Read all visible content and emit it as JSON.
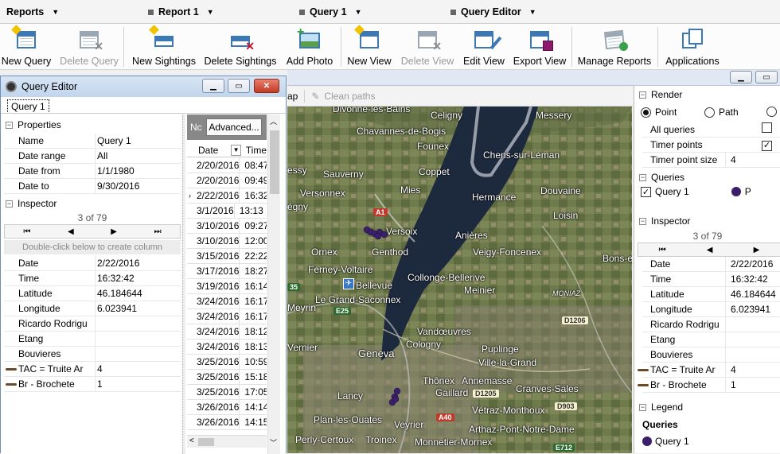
{
  "tabs": [
    {
      "label": "Reports"
    },
    {
      "label": "Report 1"
    },
    {
      "label": "Query 1"
    },
    {
      "label": "Query Editor"
    }
  ],
  "ribbon": {
    "new_query": "New Query",
    "delete_query": "Delete Query",
    "new_sightings": "New Sightings",
    "delete_sightings": "Delete Sightings",
    "add_photo": "Add Photo",
    "new_view": "New View",
    "delete_view": "Delete View",
    "edit_view": "Edit View",
    "export_view": "Export View",
    "manage_reports": "Manage Reports",
    "applications": "Applications"
  },
  "query_editor": {
    "title": "Query Editor",
    "tab": "Query 1",
    "properties_header": "Properties",
    "properties": [
      {
        "key": "Name",
        "value": "Query 1"
      },
      {
        "key": "Date range",
        "value": "All"
      },
      {
        "key": "Date from",
        "value": "1/1/1980"
      },
      {
        "key": "Date to",
        "value": "9/30/2016"
      }
    ],
    "inspector_header": "Inspector",
    "inspector_count": "3 of 79",
    "create_column_hint": "Double-click below to create column",
    "inspector": [
      {
        "key": "Date",
        "value": "2/22/2016"
      },
      {
        "key": "Time",
        "value": "16:32:42"
      },
      {
        "key": "Latitude",
        "value": "46.184644"
      },
      {
        "key": "Longitude",
        "value": "6.023941"
      },
      {
        "key": "Ricardo Rodrigu",
        "value": ""
      },
      {
        "key": "Etang",
        "value": ""
      },
      {
        "key": "Bouvieres",
        "value": ""
      },
      {
        "key": "TAC = Truite Ar",
        "value": "4"
      },
      {
        "key": "Br - Brochete",
        "value": "1"
      }
    ],
    "advanced_label": "Advanced...",
    "nc_label": "Nc",
    "date_col": "Date",
    "time_col": "Time",
    "rows": [
      {
        "date": "2/20/2016",
        "time": "08:47"
      },
      {
        "date": "2/20/2016",
        "time": "09:49"
      },
      {
        "date": "2/22/2016",
        "time": "16:32"
      },
      {
        "date": "3/1/2016",
        "time": "13:13"
      },
      {
        "date": "3/10/2016",
        "time": "09:27"
      },
      {
        "date": "3/10/2016",
        "time": "12:00"
      },
      {
        "date": "3/15/2016",
        "time": "22:22"
      },
      {
        "date": "3/17/2016",
        "time": "18:27"
      },
      {
        "date": "3/19/2016",
        "time": "16:14"
      },
      {
        "date": "3/24/2016",
        "time": "16:17"
      },
      {
        "date": "3/24/2016",
        "time": "16:17"
      },
      {
        "date": "3/24/2016",
        "time": "18:12"
      },
      {
        "date": "3/24/2016",
        "time": "18:13"
      },
      {
        "date": "3/25/2016",
        "time": "10:59"
      },
      {
        "date": "3/25/2016",
        "time": "15:18"
      },
      {
        "date": "3/25/2016",
        "time": "17:05"
      },
      {
        "date": "3/26/2016",
        "time": "14:14"
      },
      {
        "date": "3/26/2016",
        "time": "14:15"
      }
    ]
  },
  "map_toolbar": {
    "left_label": "ap",
    "clean_paths": "Clean paths"
  },
  "map_labels": [
    {
      "text": "Divonne-les-Bains"
    },
    {
      "text": "Celigny"
    },
    {
      "text": "Messery"
    },
    {
      "text": "Chavannes-de-Bogis"
    },
    {
      "text": "Founex"
    },
    {
      "text": "Chens-sur-Léman"
    },
    {
      "text": "essy"
    },
    {
      "text": "Sauverny"
    },
    {
      "text": "Coppet"
    },
    {
      "text": "Versonnex"
    },
    {
      "text": "Mies"
    },
    {
      "text": "Hermance"
    },
    {
      "text": "Douvaine"
    },
    {
      "text": "égny"
    },
    {
      "text": "Loisin"
    },
    {
      "text": "Versoix"
    },
    {
      "text": "Anières"
    },
    {
      "text": "Ornex"
    },
    {
      "text": "Genthod"
    },
    {
      "text": "Veigy-Foncenex"
    },
    {
      "text": "Bons-e"
    },
    {
      "text": "Ferney-Voltaire"
    },
    {
      "text": "Collonge-Bellerive"
    },
    {
      "text": "Bellevue"
    },
    {
      "text": "Meinier"
    },
    {
      "text": "Meyrin"
    },
    {
      "text": "Le Grand-Saconnex"
    },
    {
      "text": "Vandœuvres"
    },
    {
      "text": "Vernier"
    },
    {
      "text": "Cologny"
    },
    {
      "text": "Puplinge"
    },
    {
      "text": "Geneva"
    },
    {
      "text": "Ville-la-Grand"
    },
    {
      "text": "Thônex"
    },
    {
      "text": "Annemasse"
    },
    {
      "text": "Gaillard"
    },
    {
      "text": "Cranves-Sales"
    },
    {
      "text": "Lancy"
    },
    {
      "text": "Plan-les-Ouates"
    },
    {
      "text": "Veyrier"
    },
    {
      "text": "Vétraz-Monthoux"
    },
    {
      "text": "Arthaz-Pont-Notre-Dame"
    },
    {
      "text": "Perly-Certoux"
    },
    {
      "text": "Troinex"
    },
    {
      "text": "Monnetier-Mornex"
    },
    {
      "text": "MONIAZ"
    }
  ],
  "road_labels": [
    {
      "text": "A1"
    },
    {
      "text": "35"
    },
    {
      "text": "E25"
    },
    {
      "text": "D1206"
    },
    {
      "text": "D1205"
    },
    {
      "text": "A40"
    },
    {
      "text": "D903"
    },
    {
      "text": "E712"
    }
  ],
  "right_panel": {
    "render_header": "Render",
    "render_options": [
      "Point",
      "Path"
    ],
    "selected_render": "Point",
    "render_rows": [
      {
        "key": "All queries",
        "checked": false
      },
      {
        "key": "Timer points",
        "checked": true
      }
    ],
    "timer_point_size_label": "Timer point size",
    "timer_point_size": "4",
    "queries_header": "Queries",
    "query_item": "Query 1",
    "query_marker": "P",
    "inspector_header": "Inspector",
    "inspector_count": "3 of 79",
    "inspector": [
      {
        "key": "Date",
        "value": "2/22/2016"
      },
      {
        "key": "Time",
        "value": "16:32:42"
      },
      {
        "key": "Latitude",
        "value": "46.184644"
      },
      {
        "key": "Longitude",
        "value": "6.023941"
      },
      {
        "key": "Ricardo Rodrigu",
        "value": ""
      },
      {
        "key": "Etang",
        "value": ""
      },
      {
        "key": "Bouvieres",
        "value": ""
      },
      {
        "key": "TAC = Truite Ar",
        "value": "4"
      },
      {
        "key": "Br - Brochete",
        "value": "1"
      }
    ],
    "legend_header": "Legend",
    "legend_title": "Queries",
    "legend_item": "Query 1"
  },
  "colors": {
    "accent": "#3c78b4",
    "point": "#3b1f6b",
    "lake": "#1d2a3e"
  }
}
